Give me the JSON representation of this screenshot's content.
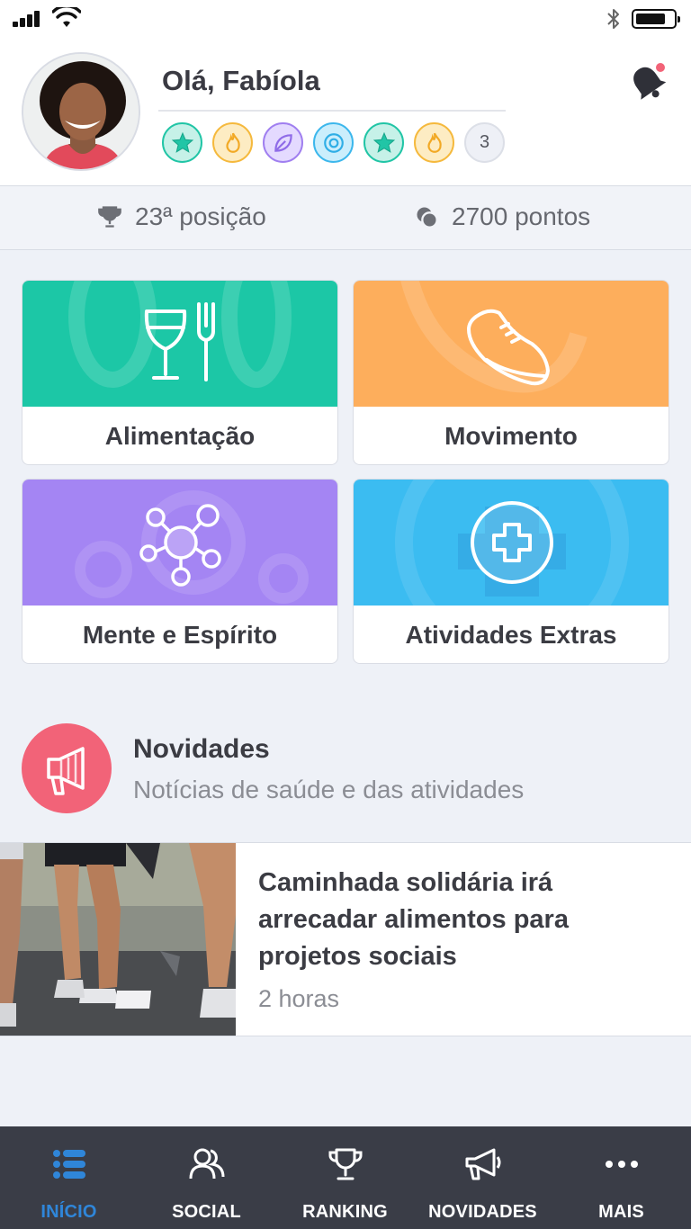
{
  "colors": {
    "accent": "#2f86d9",
    "food": "#1cc7a6",
    "movement": "#fdae5c",
    "mind": "#a485f3",
    "extras": "#3bbcf1",
    "news": "#f26378",
    "tabbar": "#3a3d47"
  },
  "header": {
    "greeting": "Olá, Fabíola",
    "badges": [
      {
        "icon": "star-icon",
        "color": "#21c5a6"
      },
      {
        "icon": "flame-icon",
        "color": "#f5b93d"
      },
      {
        "icon": "leaf-icon",
        "color": "#a07ff0"
      },
      {
        "icon": "target-icon",
        "color": "#3cb7ec"
      },
      {
        "icon": "star-icon",
        "color": "#21c5a6"
      },
      {
        "icon": "flame-icon",
        "color": "#f5b93d"
      }
    ],
    "more_badges": "3"
  },
  "stats": {
    "position": "23ª posição",
    "points": "2700 pontos"
  },
  "categories": [
    {
      "label": "Alimentação",
      "icon": "wine-glass-fork-icon"
    },
    {
      "label": "Movimento",
      "icon": "sneaker-icon"
    },
    {
      "label": "Mente e Espírito",
      "icon": "molecule-icon"
    },
    {
      "label": "Atividades Extras",
      "icon": "plus-circle-icon"
    }
  ],
  "news": {
    "title": "Novidades",
    "subtitle": "Notícias de saúde e das atividades",
    "items": [
      {
        "headline": "Caminhada solidária irá arrecadar alimentos para projetos sociais",
        "time": "2 horas"
      }
    ]
  },
  "tabbar": {
    "items": [
      {
        "label": "INÍCIO",
        "icon": "list-icon",
        "active": true
      },
      {
        "label": "SOCIAL",
        "icon": "users-icon",
        "active": false
      },
      {
        "label": "RANKING",
        "icon": "trophy-icon",
        "active": false
      },
      {
        "label": "NOVIDADES",
        "icon": "megaphone-icon",
        "active": false
      },
      {
        "label": "MAIS",
        "icon": "more-dots-icon",
        "active": false
      }
    ]
  }
}
